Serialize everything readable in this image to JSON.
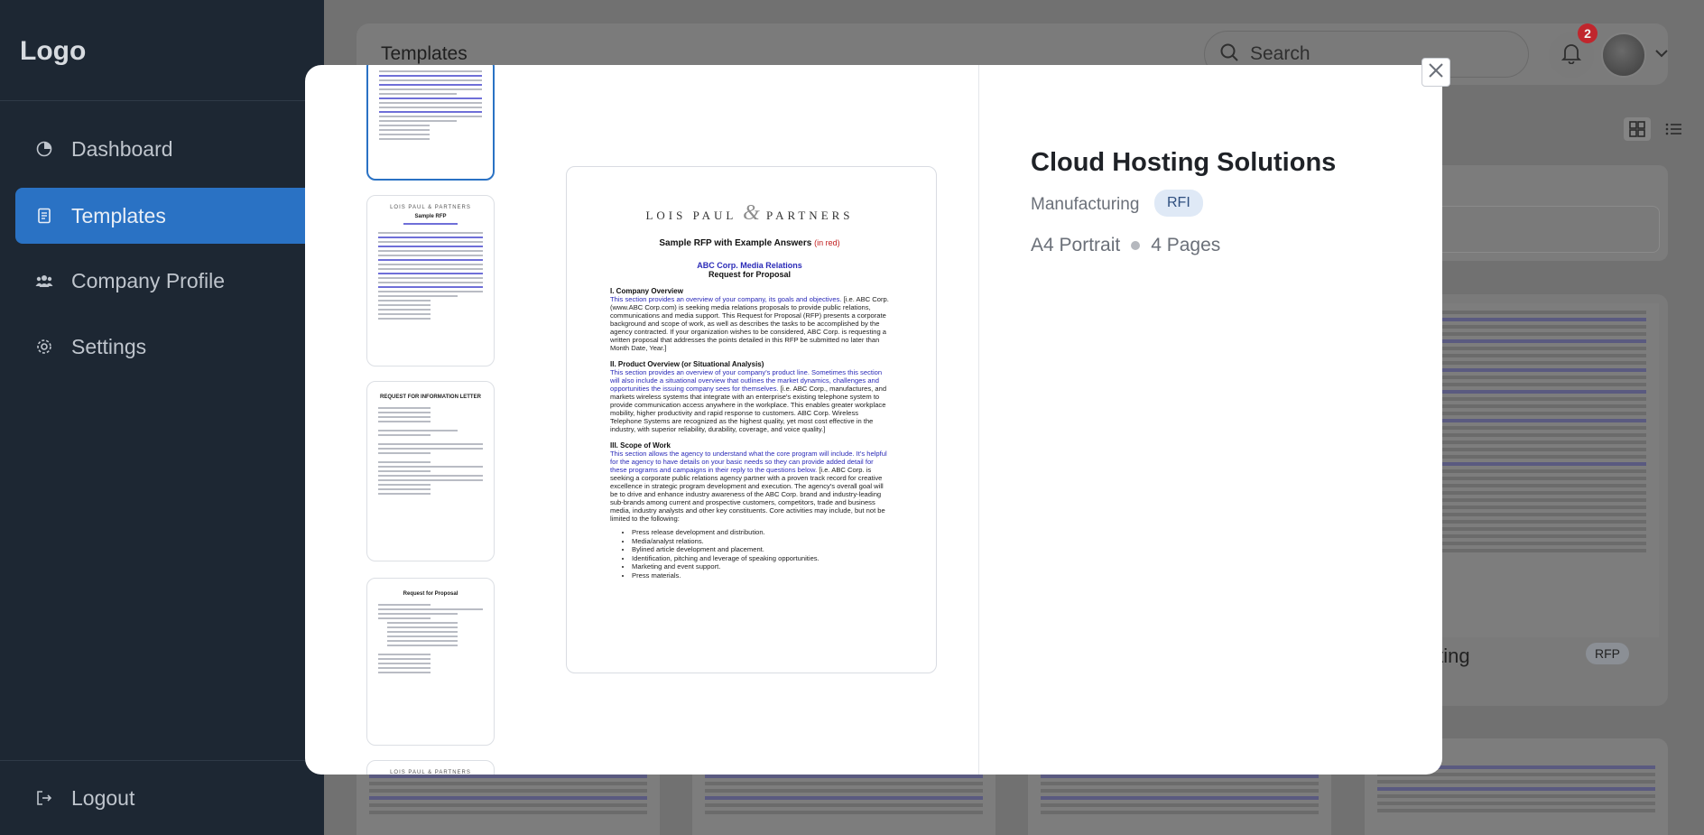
{
  "sidebar": {
    "logo": "Logo",
    "items": [
      {
        "label": "Dashboard",
        "icon": "pie-chart-icon"
      },
      {
        "label": "Templates",
        "icon": "document-icon",
        "active": true
      },
      {
        "label": "Company Profile",
        "icon": "users-icon"
      },
      {
        "label": "Settings",
        "icon": "gear-icon"
      }
    ],
    "logout": "Logout"
  },
  "header": {
    "title": "Templates",
    "search_placeholder": "Search",
    "notification_count": "2"
  },
  "background_cards": [
    {
      "title": "Marketing",
      "tag": "RFP"
    }
  ],
  "modal": {
    "preview": {
      "brand_left": "LOIS PAUL",
      "brand_amp": "&",
      "brand_right": "PARTNERS",
      "title": "Sample RFP with Example Answers",
      "title_note": "(in red)",
      "sub1": "ABC Corp. Media Relations",
      "sub2": "Request for Proposal",
      "s1_head": "I. Company Overview",
      "s1_blue": "This section provides an overview of your company, its goals and objectives.",
      "s1_body": "[i.e. ABC Corp. (www.ABC Corp.com) is seeking media relations proposals to provide public relations, communications and media support. This Request for Proposal (RFP) presents a corporate background and scope of work, as well as describes the tasks to be accomplished by the agency contracted. If your organization wishes to be considered, ABC Corp. is requesting a written proposal that addresses the points detailed in this RFP be submitted no later than Month Date, Year.]",
      "s2_head": "II. Product Overview (or Situational Analysis)",
      "s2_blue": "This section provides an overview of your company's product line. Sometimes this section will also include a situational overview that outlines the market dynamics, challenges and opportunities the issuing company sees for themselves.",
      "s2_body": "[i.e. ABC Corp., manufactures, and markets wireless systems that integrate with an enterprise's existing telephone system to provide communication access anywhere in the workplace. This enables greater workplace mobility, higher productivity and rapid response to customers. ABC Corp. Wireless Telephone Systems are recognized as the highest quality, yet most cost effective in the industry, with superior reliability, durability, coverage, and voice quality.]",
      "s3_head": "III. Scope of Work",
      "s3_blue": "This section allows the agency to understand what the core program will include. It's helpful for the agency to have details on your basic needs so they can provide added detail for these programs and campaigns in their reply to the questions below.",
      "s3_body": "[i.e. ABC Corp. is seeking a corporate public relations agency partner with a proven track record for creative excellence in strategic program development and execution. The agency's overall goal will be to drive and enhance industry awareness of the ABC Corp. brand and industry-leading sub-brands among current and prospective customers, competitors, trade and business media, industry analysts and other key constituents. Core activities may include, but not be limited to the following:",
      "bullets": [
        "Press release development and distribution.",
        "Media/analyst relations.",
        "Bylined article development and placement.",
        "Identification, pitching and leverage of speaking opportunities.",
        "Marketing and event support.",
        "Press materials."
      ]
    },
    "info": {
      "title": "Cloud Hosting Solutions",
      "category": "Manufacturing",
      "tag": "RFI",
      "format": "A4 Portrait",
      "pages": "4 Pages"
    }
  },
  "colors": {
    "sidebar_bg": "#1d2733",
    "active_nav": "#2a72c4",
    "tag_bg": "#dfe9f6",
    "badge": "#c0262d"
  }
}
